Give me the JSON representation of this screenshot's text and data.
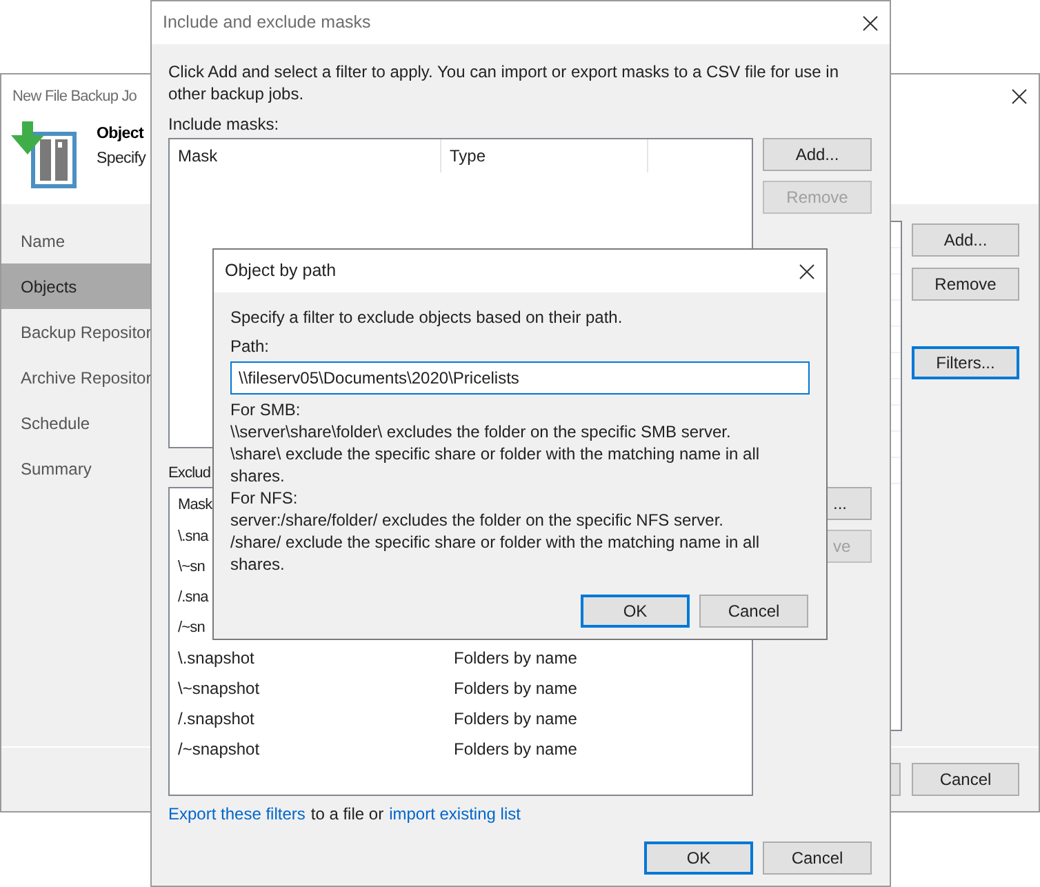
{
  "background_window": {
    "title": "New File Backup Jo",
    "header": {
      "title": "Object",
      "subtitle": "Specify"
    },
    "steps": [
      {
        "label": "Name",
        "selected": false
      },
      {
        "label": "Objects",
        "selected": true
      },
      {
        "label": "Backup Repositor",
        "selected": false
      },
      {
        "label": "Archive Repositor",
        "selected": false
      },
      {
        "label": "Schedule",
        "selected": false
      },
      {
        "label": "Summary",
        "selected": false
      }
    ],
    "buttons": [
      {
        "label": "Add...",
        "focused": false
      },
      {
        "label": "Remove",
        "focused": false
      },
      {
        "label": "Filters...",
        "focused": true
      }
    ],
    "footer_buttons": [
      {
        "label": "Cancel"
      }
    ]
  },
  "masks_dialog": {
    "title": "Include and exclude masks",
    "description": "Click Add and select a filter to apply. You can import or export masks to a CSV file for use in other backup jobs.",
    "include_label": "Include masks:",
    "include_columns": [
      "Mask",
      "Type"
    ],
    "include_buttons": [
      {
        "label": "Add...",
        "disabled": false
      },
      {
        "label": "Remove",
        "disabled": true
      }
    ],
    "exclude_label": "Exclud",
    "exclude_columns": [
      "Mask"
    ],
    "exclude_rows": [
      {
        "mask": "\\.sna"
      },
      {
        "mask": "\\~sn"
      },
      {
        "mask": "/.sna"
      },
      {
        "mask": "/~sn"
      },
      {
        "mask": "\\.snapshot",
        "type": "Folders by name"
      },
      {
        "mask": "\\~snapshot",
        "type": "Folders by name"
      },
      {
        "mask": "/.snapshot",
        "type": "Folders by name"
      },
      {
        "mask": "/~snapshot",
        "type": "Folders by name"
      }
    ],
    "exclude_buttons": [
      {
        "label": "...",
        "disabled": false
      },
      {
        "label": "ve",
        "disabled": true
      }
    ],
    "footer_text": [
      {
        "kind": "link",
        "text": "Export these filters"
      },
      {
        "kind": "text",
        "text": "to a file or"
      },
      {
        "kind": "link",
        "text": "import existing list"
      }
    ],
    "buttons": [
      {
        "label": "OK",
        "focused": true
      },
      {
        "label": "Cancel",
        "focused": false
      }
    ]
  },
  "path_dialog": {
    "title": "Object by path",
    "description": "Specify a filter to exclude objects based on their path.",
    "path_label": "Path:",
    "path_value": "\\\\fileserv05\\Documents\\2020\\Pricelists",
    "help_lines": [
      "For SMB:",
      "\\\\server\\share\\folder\\ excludes the folder on the specific SMB server.",
      "\\share\\ exclude the specific share or folder with the matching name in all shares.",
      "For NFS:",
      "server:/share/folder/ excludes the folder on the specific NFS server.",
      "/share/ exclude the specific share or folder with the matching name in all shares."
    ],
    "buttons": [
      {
        "label": "OK",
        "focused": true
      },
      {
        "label": "Cancel",
        "focused": false
      }
    ]
  }
}
